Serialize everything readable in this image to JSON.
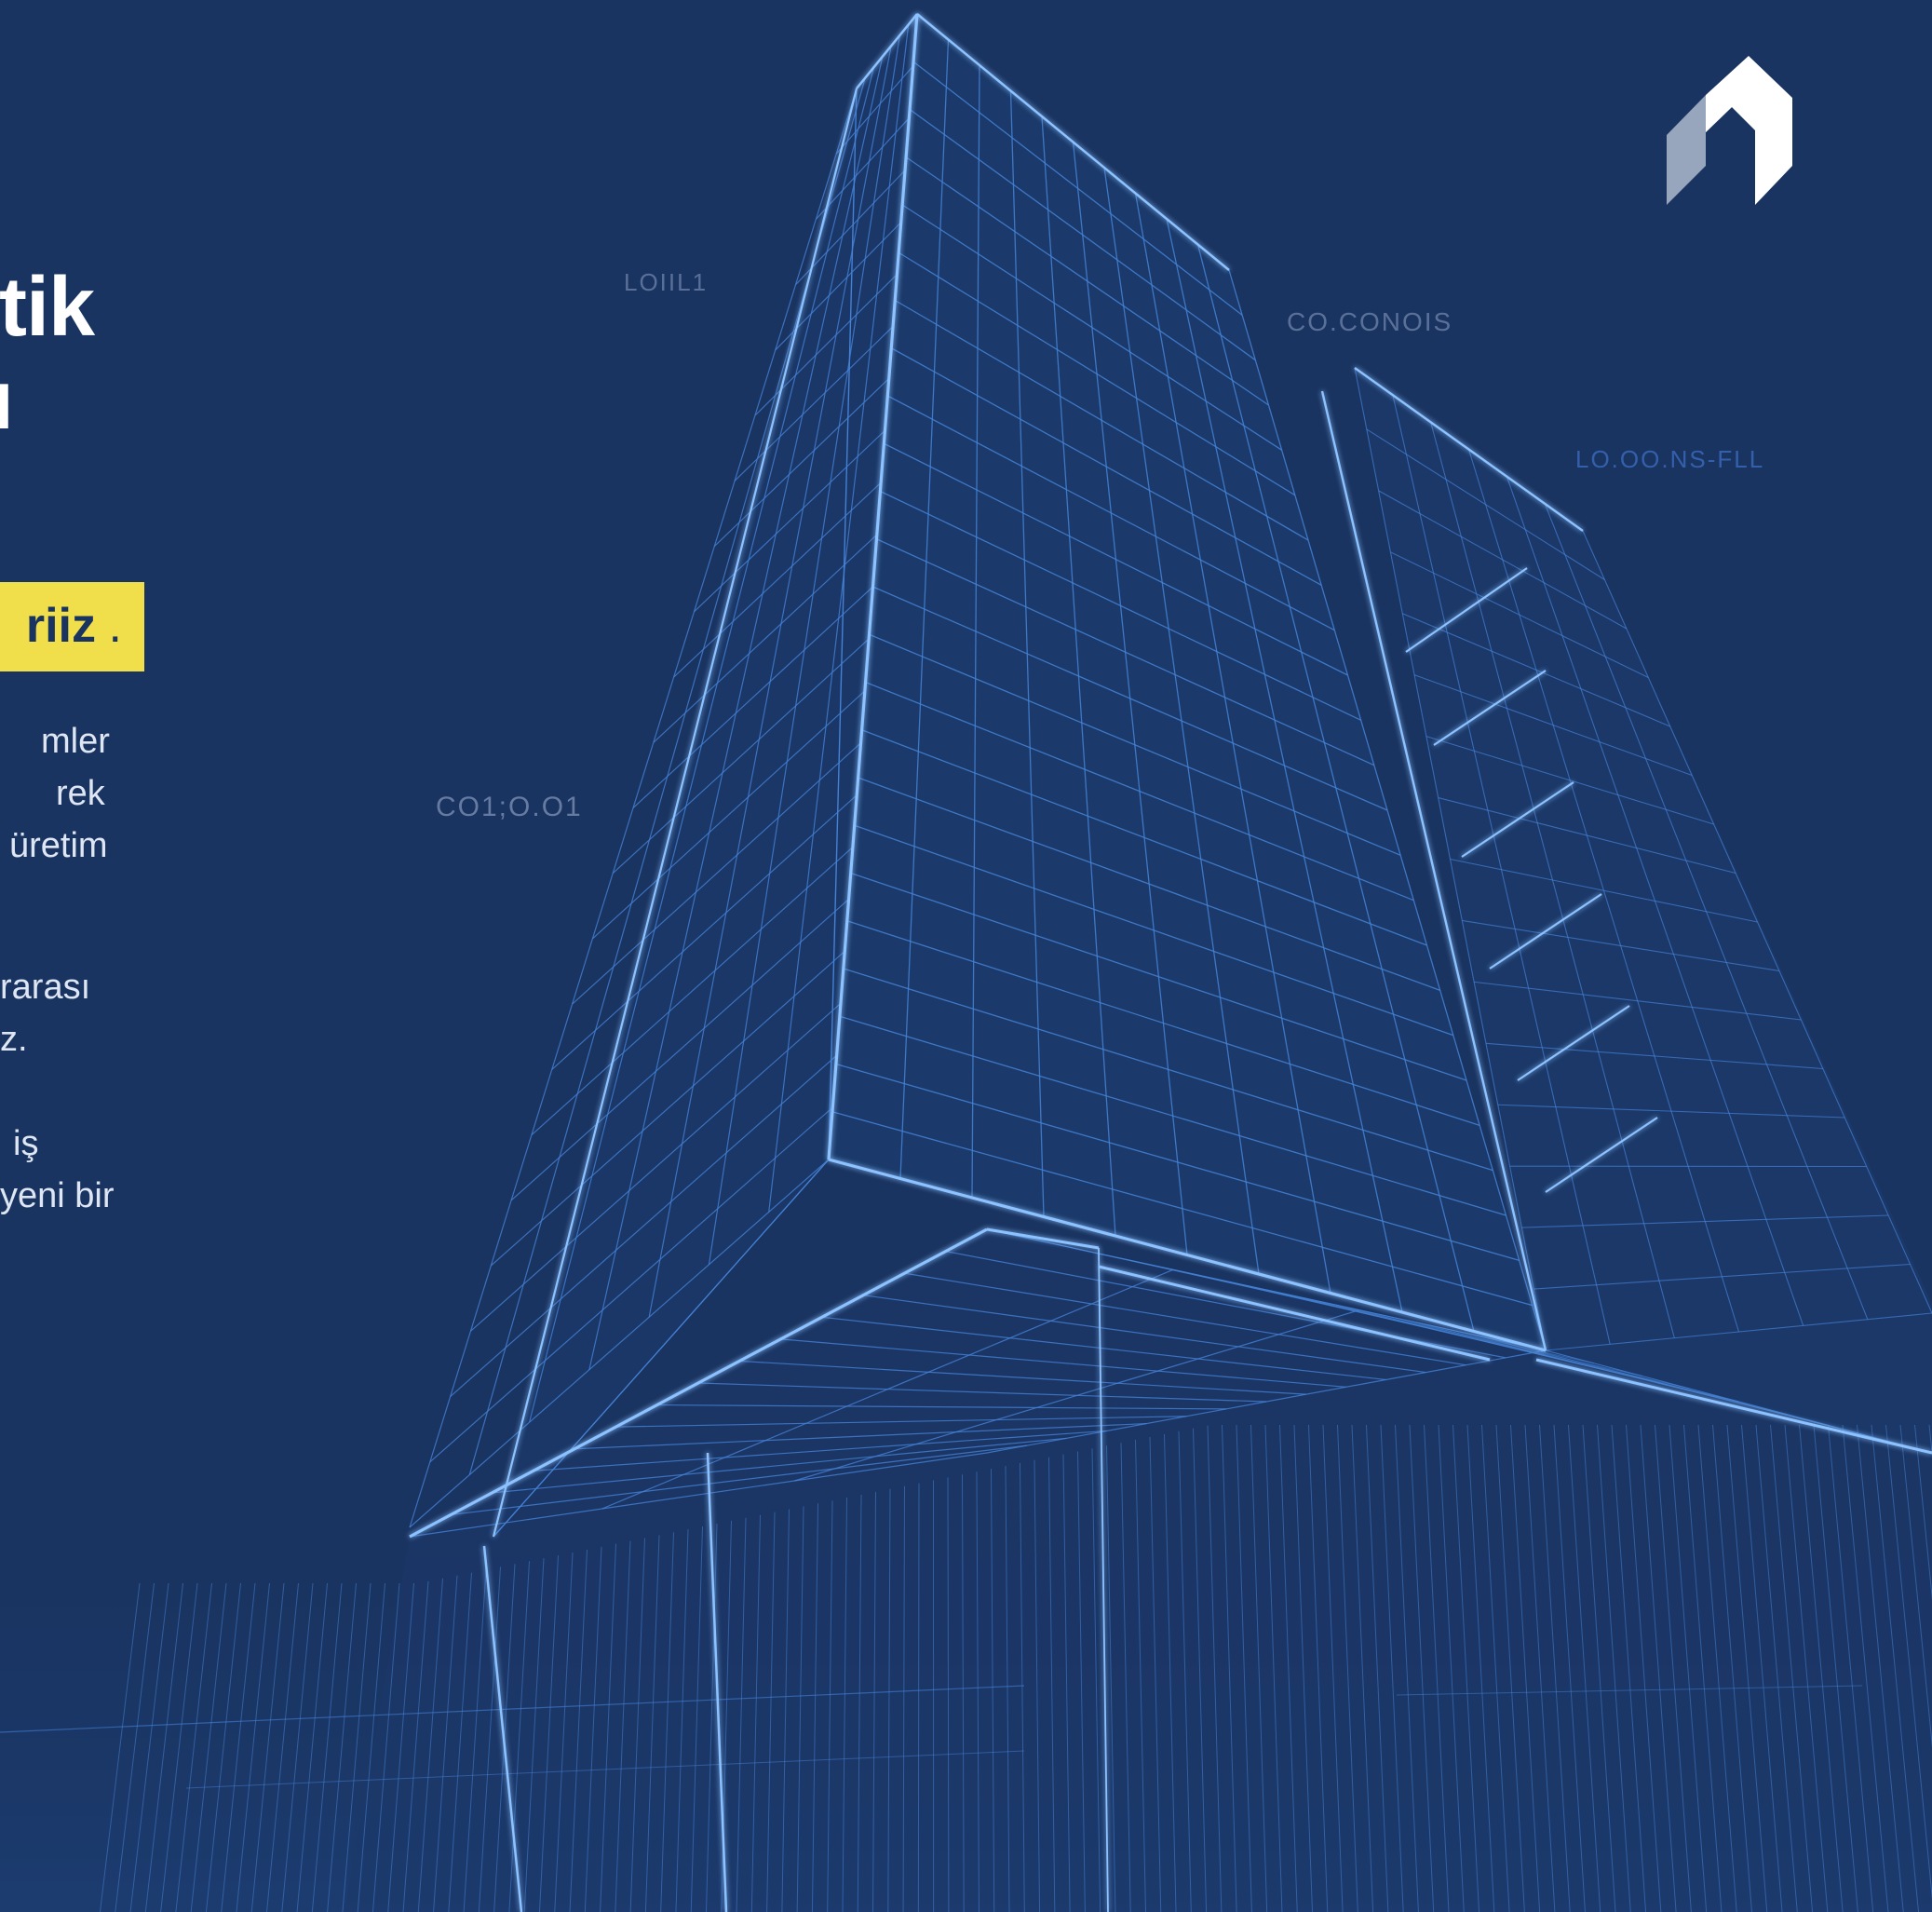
{
  "hero": {
    "headline_line1": "etik",
    "headline_line2": "ı",
    "highlight_text": "riiz",
    "highlight_dot": ".",
    "paragraph1": [
      "mler",
      "rek",
      "üretim"
    ],
    "paragraph2": [
      "rarası",
      "z."
    ],
    "paragraph3": [
      "iş",
      "yeni bir"
    ]
  },
  "drawing_labels": {
    "label1": "LOIIL1",
    "label2": "CO.CONOIS",
    "label3": "LO.OO.NS-FLL",
    "label4": "CO1;O.O1"
  },
  "colors": {
    "background": "#1a3461",
    "highlight": "#f0df4a",
    "wireframe": "#4d8fe8",
    "wireframe_glow": "#8cc2ff"
  },
  "icons": {
    "logo": "house-arrow-logo"
  }
}
